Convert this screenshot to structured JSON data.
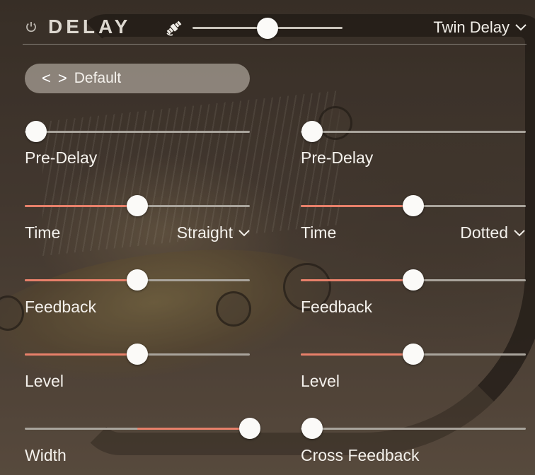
{
  "header": {
    "title": "DELAY",
    "mix_value": 0.5,
    "preset_type": "Twin Delay"
  },
  "preset": {
    "prev_label": "<",
    "next_label": ">",
    "name": "Default"
  },
  "left": {
    "pre_delay": {
      "label": "Pre-Delay",
      "value": 0.05
    },
    "time": {
      "label": "Time",
      "value": 0.5,
      "mode": "Straight"
    },
    "feedback": {
      "label": "Feedback",
      "value": 0.5
    },
    "level": {
      "label": "Level",
      "value": 0.5
    },
    "width": {
      "label": "Width",
      "value": 1.0,
      "bipolar": true
    }
  },
  "right": {
    "pre_delay": {
      "label": "Pre-Delay",
      "value": 0.05
    },
    "time": {
      "label": "Time",
      "value": 0.5,
      "mode": "Dotted"
    },
    "feedback": {
      "label": "Feedback",
      "value": 0.5
    },
    "level": {
      "label": "Level",
      "value": 0.5
    },
    "cross_feedback": {
      "label": "Cross Feedback",
      "value": 0.05
    }
  },
  "colors": {
    "accent": "#e8806a",
    "track": "#a9a49c",
    "thumb": "#fbfaf8",
    "text": "#f4f1ec"
  },
  "icons": {
    "power": "power-icon",
    "macro": "satellite-icon",
    "chevron": "chevron-down-icon"
  }
}
